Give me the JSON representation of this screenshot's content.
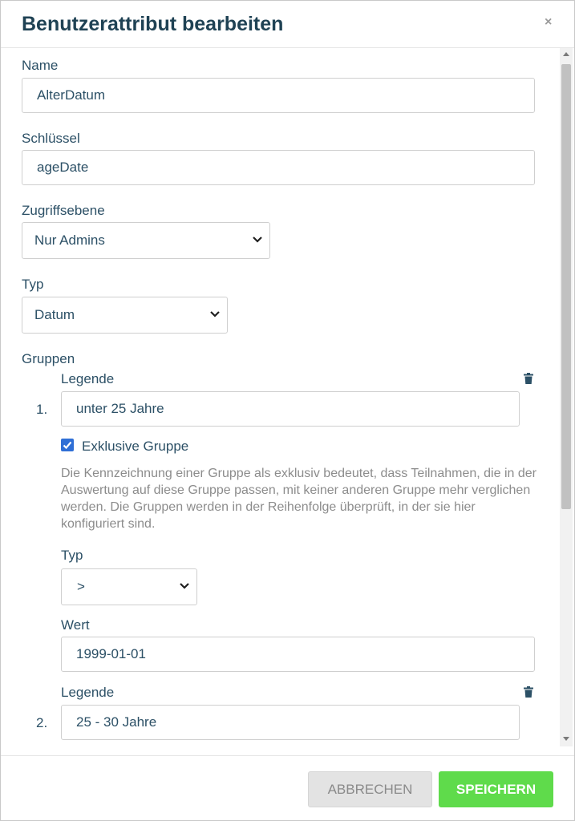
{
  "dialog": {
    "title": "Benutzerattribut bearbeiten",
    "close_symbol": "×"
  },
  "form": {
    "name": {
      "label": "Name",
      "value": "AlterDatum"
    },
    "key": {
      "label": "Schlüssel",
      "value": "ageDate"
    },
    "access": {
      "label": "Zugriffsebene",
      "value": "Nur Admins"
    },
    "type": {
      "label": "Typ",
      "value": "Datum"
    },
    "groups_label": "Gruppen",
    "groups": [
      {
        "number": "1.",
        "legend_label": "Legende",
        "legend_value": "unter 25 Jahre",
        "exclusive_label": "Exklusive Gruppe",
        "exclusive_checked": true,
        "exclusive_description": "Die Kennzeichnung einer Gruppe als exklusiv bedeutet, dass Teilnahmen, die in der Auswertung auf diese Gruppe passen, mit keiner anderen Gruppe mehr verglichen werden. Die Gruppen werden in der Reihenfolge überprüft, in der sie hier konfiguriert sind.",
        "type_label": "Typ",
        "type_value": ">",
        "value_label": "Wert",
        "value_value": "1999-01-01"
      },
      {
        "number": "2.",
        "legend_label": "Legende",
        "legend_value": "25 - 30 Jahre"
      }
    ]
  },
  "footer": {
    "cancel_label": "ABBRECHEN",
    "save_label": "SPEICHERN"
  },
  "icons": {
    "close": "close-icon",
    "chevron": "chevron-down-icon",
    "delete": "trash-icon",
    "check": "checkmark-icon"
  },
  "colors": {
    "title": "#1f4254",
    "text": "#2c5066",
    "checkbox": "#2f6fd6",
    "save_button": "#5fdb4b",
    "cancel_button": "#e3e3e3"
  }
}
